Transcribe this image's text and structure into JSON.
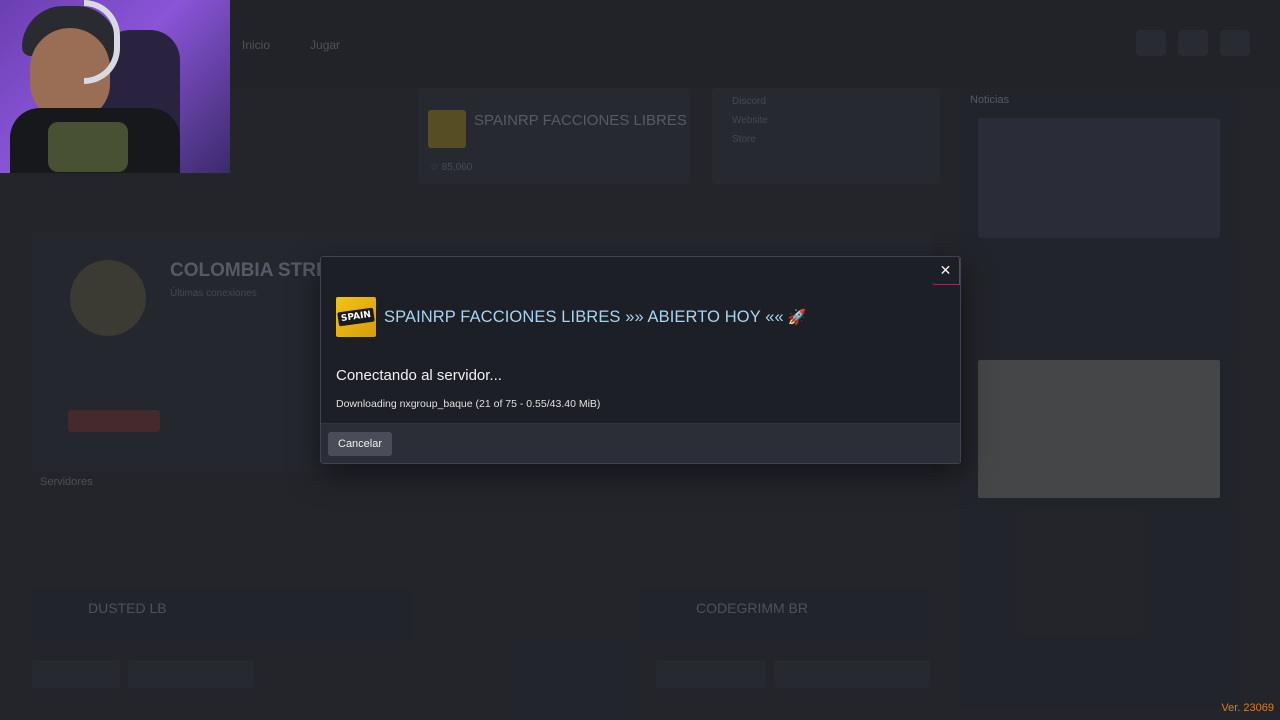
{
  "background": {
    "nav": [
      "Inicio",
      "Jugar"
    ],
    "server_card": {
      "name": "SPAINRP FACCIONES LIBRES",
      "meta": "☆ 85,060"
    },
    "links": [
      "Discord",
      "Website",
      "Store"
    ],
    "sidebar_title": "Noticias",
    "main_title": "COLOMBIA STRE",
    "main_sub": "Últimas conexiones",
    "section_label": "Servidores",
    "bottom_left_title": "DUSTED LB",
    "bottom_right_title": "CODEGRIMM BR"
  },
  "modal": {
    "server_name": "SPAINRP FACCIONES LIBRES »» ABIERTO HOY ««",
    "server_badge": "SPAIN",
    "rocket_icon": "🚀",
    "status_title": "Conectando al servidor...",
    "status_detail": "Downloading nxgroup_baque (21 of 75 - 0.55/43.40 MiB)",
    "cancel_label": "Cancelar",
    "close_symbol": "✕"
  },
  "version": "Ver. 23069",
  "colors": {
    "server_name": "#a9d3f2",
    "version": "#e07b1a",
    "close_accent": "#c2185b"
  }
}
